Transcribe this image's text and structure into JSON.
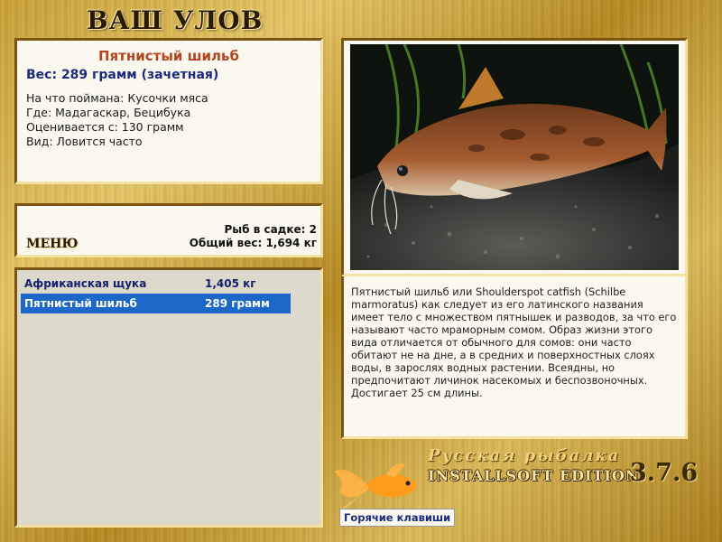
{
  "header": {
    "title": "ВАШ УЛОВ"
  },
  "info": {
    "name": "Пятнистый шильб",
    "weight": "Вес: 289 грамм (зачетная)",
    "lines": [
      "На что поймана: Кусочки мяса",
      "Где: Мадагаскар, Бецибука",
      "Оценивается с: 130 грамм",
      "Вид: Ловится часто"
    ]
  },
  "cage": {
    "menu_label": "МЕНЮ",
    "fish_count": "Рыб в садке: 2",
    "total_weight": "Общий вес: 1,694 кг"
  },
  "catch_list": [
    {
      "name": "Африканская щука",
      "weight": "1,405 кг",
      "selected": false
    },
    {
      "name": "Пятнистый шильб",
      "weight": "289 грамм",
      "selected": true
    }
  ],
  "description": "Пятнистый шильб или Shoulderspot catfish (Schilbe marmoratus) как следует из его латинского названия имеет тело с множеством пятнышек и разводов, за что его называют часто мраморным сомом. Образ жизни этого вида отличается от обычного для сомов: они часто обитают не на дне, а в средних и поверхностных слоях воды, в зарослях водных растении. Всеядны, но предпочитают личинок насекомых и беспозвоночных. Достигает 25 см длины.",
  "branding": {
    "line1": "Русская рыбалка",
    "line2": "INSTALLSOFT EDITION",
    "version": "3.7.6"
  },
  "footer": {
    "hotkeys_label": "Горячие клавиши"
  },
  "colors": {
    "accent_name": "#b3461e",
    "selection": "#1c67c8",
    "link": "#1b2a7a"
  }
}
